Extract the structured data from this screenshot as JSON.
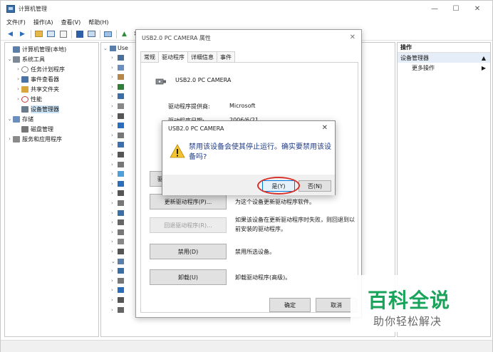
{
  "window": {
    "title": "计算机管理",
    "controls": {
      "minimize": "—",
      "maximize": "☐",
      "close": "✕"
    }
  },
  "menu": [
    "文件(F)",
    "操作(A)",
    "查看(V)",
    "帮助(H)"
  ],
  "tree": [
    {
      "label": "计算机管理(本地)",
      "arrow": "",
      "icon_color": "#5b7fa8",
      "level": 0
    },
    {
      "label": "系统工具",
      "arrow": "⌄",
      "icon_color": "#7d8a96",
      "level": 1
    },
    {
      "label": "任务计划程序",
      "arrow": "›",
      "icon_color": "#808080",
      "level": 2
    },
    {
      "label": "事件查看器",
      "arrow": "›",
      "icon_color": "#4c73a6",
      "level": 2
    },
    {
      "label": "共享文件夹",
      "arrow": "›",
      "icon_color": "#d8a63a",
      "level": 2
    },
    {
      "label": "性能",
      "arrow": "›",
      "icon_color": "#c23a3a",
      "level": 2
    },
    {
      "label": "设备管理器",
      "arrow": "",
      "icon_color": "#6a7b8c",
      "level": 2,
      "selected": true
    },
    {
      "label": "存储",
      "arrow": "⌄",
      "icon_color": "#6a8fbf",
      "level": 1
    },
    {
      "label": "磁盘管理",
      "arrow": "",
      "icon_color": "#777777",
      "level": 2
    },
    {
      "label": "服务和应用程序",
      "arrow": "›",
      "icon_color": "#8a8a8a",
      "level": 1
    }
  ],
  "device_list": {
    "root_label": "Use"
  },
  "actions": {
    "header": "操作",
    "section": "设备管理器",
    "more": "更多操作"
  },
  "props": {
    "title": "USB2.0 PC CAMERA 属性",
    "tabs": [
      "常规",
      "驱动程序",
      "详细信息",
      "事件"
    ],
    "active_tab": 1,
    "device_name": "USB2.0 PC CAMERA",
    "provider_label": "驱动程序提供商:",
    "provider_value": "Microsoft",
    "date_label": "驱动程序日期:",
    "date_value": "2006/6/21",
    "buttons": {
      "details": "驱",
      "update": "更新驱动程序(P)...",
      "update_desc": "为这个设备更新驱动程序软件。",
      "rollback": "回退驱动程序(R)...",
      "rollback_desc": "如果该设备在更新驱动程序时失败，则回退到以前安装的驱动程序。",
      "disable": "禁用(D)",
      "disable_desc": "禁用所选设备。",
      "uninstall": "卸载(U)",
      "uninstall_desc": "卸载驱动程序(高级)。",
      "ok": "确定",
      "cancel": "取消"
    }
  },
  "confirm": {
    "title": "USB2.0 PC CAMERA",
    "message": "禁用该设备会使其停止运行。确实要禁用该设备吗?",
    "yes": "是(Y)",
    "no": "否(N)",
    "highlight_color": "#d8322d"
  },
  "watermark": {
    "title": "百科全说",
    "subtitle": "助你轻松解决",
    "color": "#1aa35a"
  }
}
